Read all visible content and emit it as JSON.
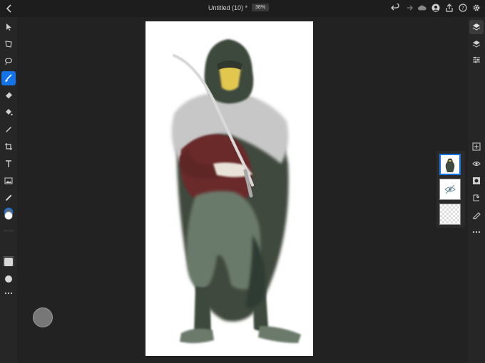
{
  "header": {
    "title": "Untitled (10) *",
    "zoom": "38%"
  },
  "toolbar": {
    "brush_size": "80",
    "active_tool": "brush"
  },
  "colors": {
    "accent": "#1473e6"
  }
}
